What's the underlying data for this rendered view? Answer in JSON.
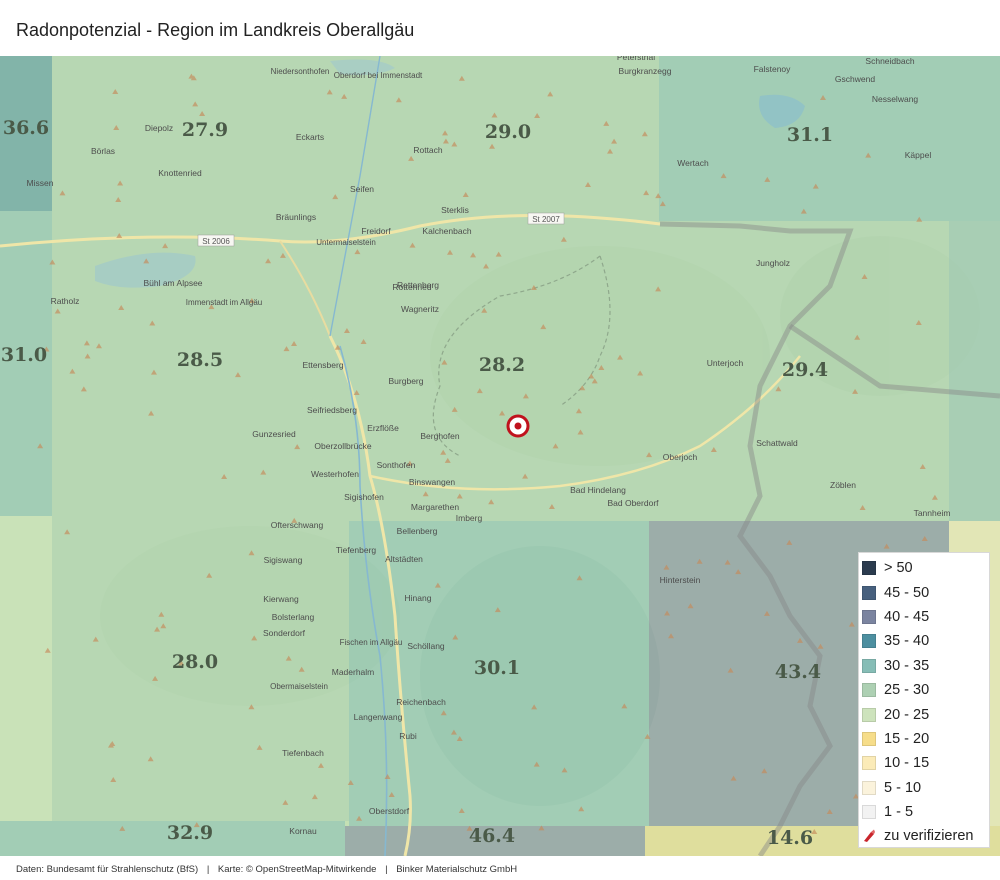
{
  "title": "Radonpotenzial - Region im Landkreis Oberallgäu",
  "colors": {
    "c_gt50": "#2b3b4e",
    "c_45_50": "#47607e",
    "c_40_45": "#7b84a0",
    "c_35_40": "#4d8fa0",
    "c_30_35": "#86bdb6",
    "c_25_30": "#add0b3",
    "c_20_25": "#cde3bc",
    "c_15_20": "#f6dd8a",
    "c_10_15": "#fbebb8",
    "c_5_10": "#fbf3dc",
    "c_1_5": "#f2f2f2",
    "verify_icon": "#c9252c",
    "marker": "#c0121d"
  },
  "cells": [
    {
      "value": "36.6"
    },
    {
      "value": "27.9"
    },
    {
      "value": "29.0"
    },
    {
      "value": "31.1"
    },
    {
      "value": "31.0"
    },
    {
      "value": "28.5"
    },
    {
      "value": "28.2"
    },
    {
      "value": "29.4"
    },
    {
      "value": "28.0"
    },
    {
      "value": "30.1"
    },
    {
      "value": "43.4"
    },
    {
      "value": "32.9"
    },
    {
      "value": "46.4"
    },
    {
      "value": "14.6"
    }
  ],
  "places": [
    "Niedersonthofen",
    "Oberdorf bei Immenstadt",
    "Petersthal",
    "Burgkranzegg",
    "Falstenoy",
    "Gschwend",
    "Schneidbach",
    "Nesselwang",
    "Käppel",
    "Diepolz",
    "Eckarts",
    "Rottach",
    "Börlas",
    "Knottenried",
    "Wertach",
    "Missen",
    "Seifen",
    "Bräunlings",
    "Freidorf",
    "Sterklis",
    "Untermaiselstein",
    "Kalchenbach",
    "Jungholz",
    "Rottenried",
    "Rettenberg",
    "Bühl am Alpsee",
    "Immenstadt im Allgäu",
    "Ratholz",
    "Wagneritz",
    "Unterjoch",
    "Ettensberg",
    "Burgberg",
    "Seifriedsberg",
    "Erzflöße",
    "Berghofen",
    "Gunzesried",
    "Oberzollbrücke",
    "Sonthofen",
    "Westerhofen",
    "Sigishofen",
    "Oberjoch",
    "Schattwald",
    "Zöblen",
    "Binswangen",
    "Bad Hindelang",
    "Bad Oberdorf",
    "Margarethen",
    "Imberg",
    "Ofterschwang",
    "Tannheim",
    "Tiefenberg",
    "Bellenberg",
    "Altstädten",
    "Hinterstein",
    "Sigiswang",
    "Kierwang",
    "Hinang",
    "Bolsterlang",
    "Sonderdorf",
    "Fischen im Allgäu",
    "Schöllang",
    "Obermaiselstein",
    "Maderhalm",
    "Reichenbach",
    "Langenwang",
    "Rubi",
    "Tiefenbach",
    "Oberstdorf",
    "Kornau"
  ],
  "road_labels": [
    "St 2006",
    "St 2007"
  ],
  "legend": [
    {
      "label": "> 50",
      "color": "#2b3b4e"
    },
    {
      "label": "45 - 50",
      "color": "#47607e"
    },
    {
      "label": "40 - 45",
      "color": "#7b84a0"
    },
    {
      "label": "35 - 40",
      "color": "#4d8fa0"
    },
    {
      "label": "30 - 35",
      "color": "#86bdb6"
    },
    {
      "label": "25 - 30",
      "color": "#add0b3"
    },
    {
      "label": "20 - 25",
      "color": "#cde3bc"
    },
    {
      "label": "15 - 20",
      "color": "#f6dd8a"
    },
    {
      "label": "10 - 15",
      "color": "#fbebb8"
    },
    {
      "label": "5 - 10",
      "color": "#fbf3dc"
    },
    {
      "label": "1 - 5",
      "color": "#f2f2f2"
    },
    {
      "label": "zu verifizieren",
      "color": "#c9252c"
    }
  ],
  "footer": {
    "source": "Daten: Bundesamt für Strahlenschutz (BfS)",
    "map": "Karte: © OpenStreetMap-Mitwirkende",
    "company": "Binker Materialschutz GmbH",
    "separator": "|"
  }
}
